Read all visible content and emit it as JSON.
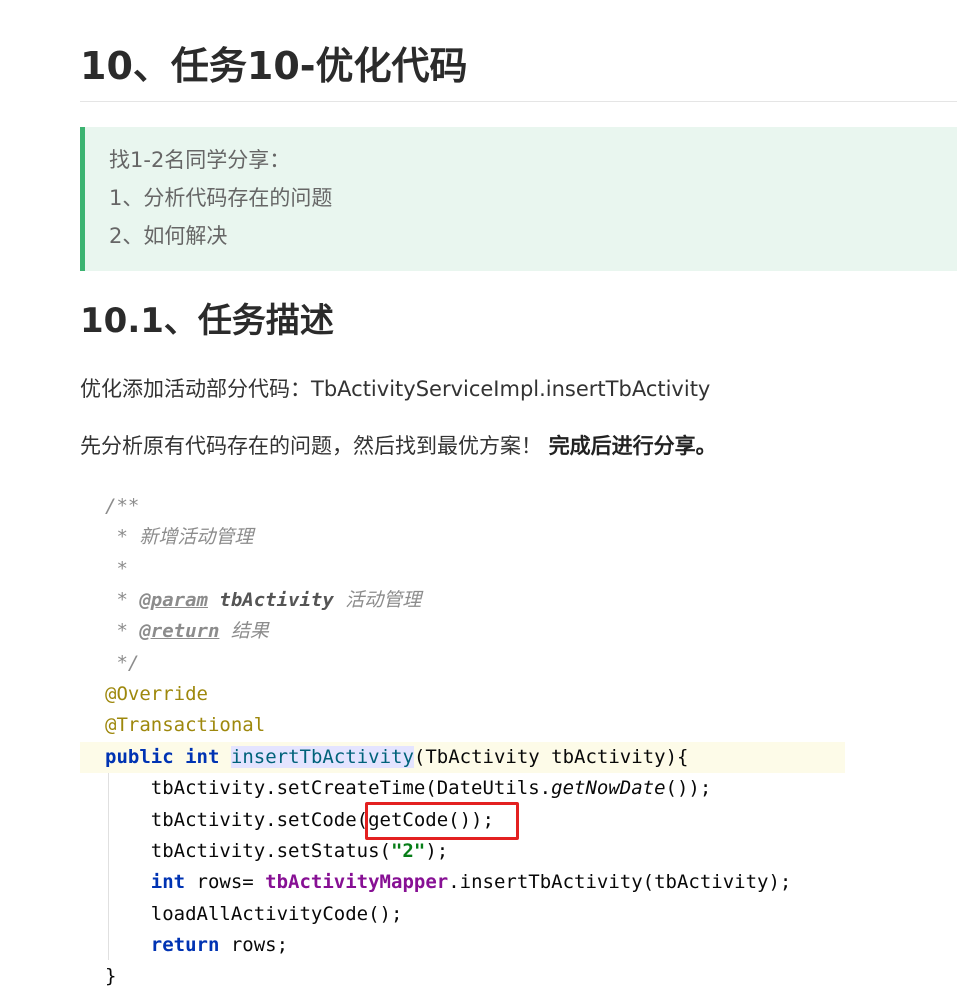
{
  "heading": "10、任务10-优化代码",
  "tip": {
    "lines": [
      "找1-2名同学分享：",
      "1、分析代码存在的问题",
      "2、如何解决"
    ]
  },
  "subheading": "10.1、任务描述",
  "paragraphs": {
    "p1": "优化添加活动部分代码：TbActivityServiceImpl.insertTbActivity",
    "p2_text": "先分析原有代码存在的问题，然后找到最优方案！ ",
    "p2_bold": "完成后进行分享。"
  },
  "code": {
    "c1": "/**",
    "c2": " * 新增活动管理",
    "c3": " *",
    "c4_star": " * ",
    "c4_tag": "@param",
    "c4_name": "tbActivity",
    "c4_desc": " 活动管理",
    "c5_star": " * ",
    "c5_tag": "@return",
    "c5_desc": " 结果",
    "c6": " */",
    "anno1": "@Override",
    "anno2": "@Transactional",
    "sig_kw1": "public",
    "sig_kw2": "int",
    "sig_fn": "insertTbActivity",
    "sig_rest": "(TbActivity tbActivity){",
    "l1_a": "    tbActivity.setCreateTime(DateUtils.",
    "l1_b": "getNowDate",
    "l1_c": "());",
    "l2": "    tbActivity.setCode(getCode());",
    "l3_a": "    tbActivity.setStatus(",
    "l3_b": "\"2\"",
    "l3_c": ");",
    "l4_kw": "int",
    "l4_a": " rows= ",
    "l4_field": "tbActivityMapper",
    "l4_b": ".insertTbActivity(tbActivity);",
    "l5": "    loadAllActivityCode();",
    "l6_kw": "return",
    "l6_a": " rows;",
    "close": "}"
  },
  "colors": {
    "tip_border": "#3cb371",
    "tip_bg": "#e9f6ef",
    "highlight_box": "#e32020"
  }
}
